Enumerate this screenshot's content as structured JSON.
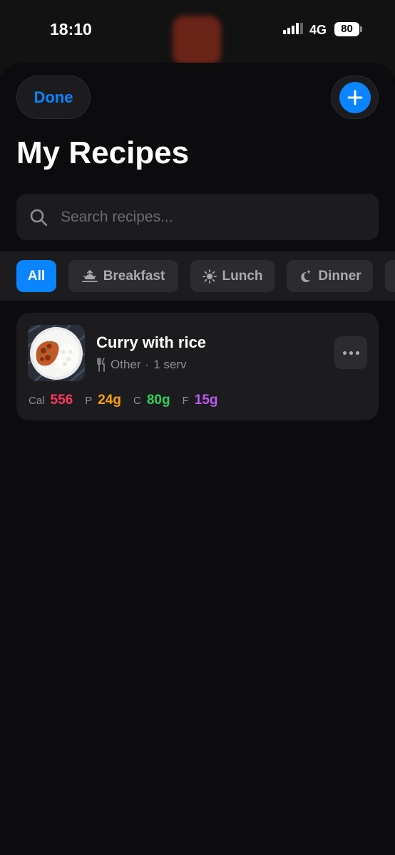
{
  "status_bar": {
    "time": "18:10",
    "network": "4G",
    "battery": "80"
  },
  "header": {
    "done_label": "Done",
    "add_icon": "plus-icon",
    "title": "My Recipes"
  },
  "search": {
    "placeholder": "Search recipes..."
  },
  "filters": [
    {
      "label": "All",
      "icon": "",
      "active": true
    },
    {
      "label": "Breakfast",
      "icon": "sunrise-icon",
      "active": false
    },
    {
      "label": "Lunch",
      "icon": "sun-icon",
      "active": false
    },
    {
      "label": "Dinner",
      "icon": "moon-stars-icon",
      "active": false
    }
  ],
  "recipes": [
    {
      "name": "Curry with rice",
      "category": "Other",
      "servings": "1 serv",
      "meta_separator": "·",
      "macros": [
        {
          "label": "Cal",
          "value": "556",
          "color": "#ff375f"
        },
        {
          "label": "P",
          "value": "24g",
          "color": "#ff9f0a"
        },
        {
          "label": "C",
          "value": "80g",
          "color": "#30d158"
        },
        {
          "label": "F",
          "value": "15g",
          "color": "#bf5af2"
        }
      ]
    }
  ],
  "colors": {
    "accent": "#0a84ff",
    "sheet": "#0c0c0e",
    "card": "#1c1c1e"
  }
}
